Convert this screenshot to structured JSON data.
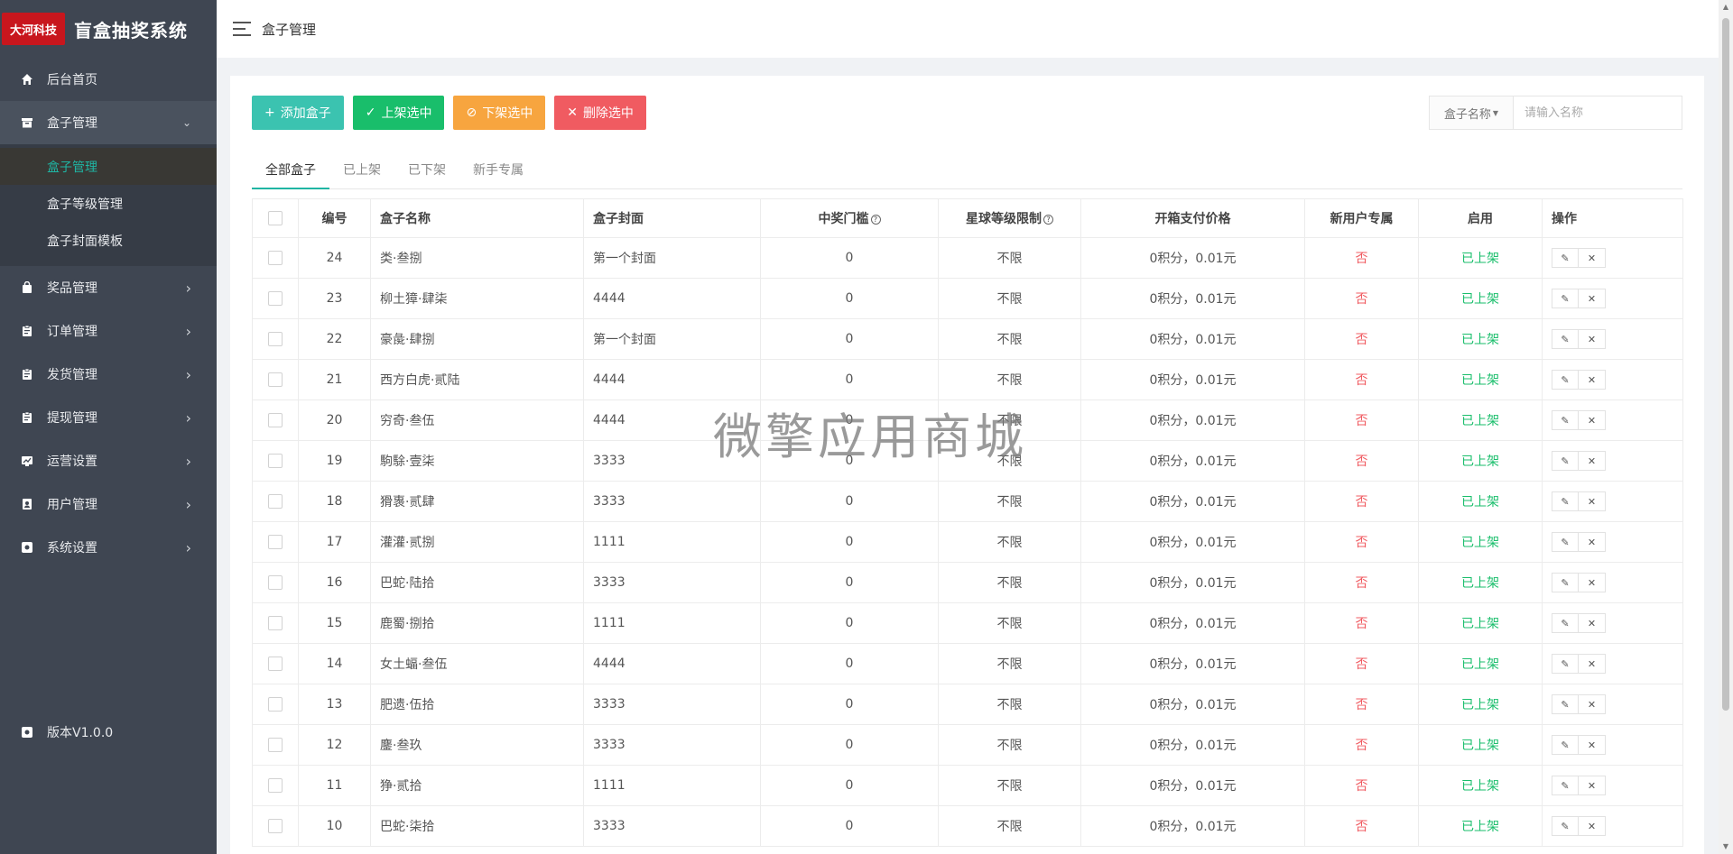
{
  "brand": {
    "logo_text": "大河科技",
    "title": "盲盒抽奖系统"
  },
  "header": {
    "title": "盒子管理"
  },
  "sidebar": {
    "items": [
      {
        "label": "后台首页",
        "icon": "home-icon",
        "has_arrow": false
      },
      {
        "label": "盒子管理",
        "icon": "archive-icon",
        "has_arrow": true,
        "open": true,
        "children": [
          {
            "label": "盒子管理",
            "active": true
          },
          {
            "label": "盒子等级管理",
            "active": false
          },
          {
            "label": "盒子封面模板",
            "active": false
          }
        ]
      },
      {
        "label": "奖品管理",
        "icon": "bag-icon",
        "has_arrow": true
      },
      {
        "label": "订单管理",
        "icon": "clipboard-icon",
        "has_arrow": true
      },
      {
        "label": "发货管理",
        "icon": "clipboard-icon",
        "has_arrow": true
      },
      {
        "label": "提现管理",
        "icon": "clipboard-icon",
        "has_arrow": true
      },
      {
        "label": "运营设置",
        "icon": "chart-icon",
        "has_arrow": true
      },
      {
        "label": "用户管理",
        "icon": "user-card-icon",
        "has_arrow": true
      },
      {
        "label": "系统设置",
        "icon": "gear-icon",
        "has_arrow": true
      }
    ],
    "version": "版本V1.0.0"
  },
  "toolbar": {
    "add_label": "添加盒子",
    "shelve_label": "上架选中",
    "unshelve_label": "下架选中",
    "delete_label": "删除选中"
  },
  "search": {
    "select_label": "盒子名称",
    "placeholder": "请输入名称"
  },
  "tabs": [
    "全部盒子",
    "已上架",
    "已下架",
    "新手专属"
  ],
  "table": {
    "headers": [
      "编号",
      "盒子名称",
      "盒子封面",
      "中奖门槛",
      "星球等级限制",
      "开箱支付价格",
      "新用户专属",
      "启用",
      "操作"
    ],
    "rows": [
      {
        "id": "24",
        "name": "类·叁捌",
        "cover": "第一个封面",
        "threshold": "0",
        "level": "不限",
        "price": "0积分，0.01元",
        "new_user": "否",
        "status": "已上架"
      },
      {
        "id": "23",
        "name": "柳土獐·肆柒",
        "cover": "4444",
        "threshold": "0",
        "level": "不限",
        "price": "0积分，0.01元",
        "new_user": "否",
        "status": "已上架"
      },
      {
        "id": "22",
        "name": "豪彘·肆捌",
        "cover": "第一个封面",
        "threshold": "0",
        "level": "不限",
        "price": "0积分，0.01元",
        "new_user": "否",
        "status": "已上架"
      },
      {
        "id": "21",
        "name": "西方白虎·贰陆",
        "cover": "4444",
        "threshold": "0",
        "level": "不限",
        "price": "0积分，0.01元",
        "new_user": "否",
        "status": "已上架"
      },
      {
        "id": "20",
        "name": "穷奇·叁伍",
        "cover": "4444",
        "threshold": "0",
        "level": "不限",
        "price": "0积分，0.01元",
        "new_user": "否",
        "status": "已上架"
      },
      {
        "id": "19",
        "name": "駒駼·壹柒",
        "cover": "3333",
        "threshold": "0",
        "level": "不限",
        "price": "0积分，0.01元",
        "new_user": "否",
        "status": "已上架"
      },
      {
        "id": "18",
        "name": "猾褢·贰肆",
        "cover": "3333",
        "threshold": "0",
        "level": "不限",
        "price": "0积分，0.01元",
        "new_user": "否",
        "status": "已上架"
      },
      {
        "id": "17",
        "name": "灌灌·贰捌",
        "cover": "1111",
        "threshold": "0",
        "level": "不限",
        "price": "0积分，0.01元",
        "new_user": "否",
        "status": "已上架"
      },
      {
        "id": "16",
        "name": "巴蛇·陆拾",
        "cover": "3333",
        "threshold": "0",
        "level": "不限",
        "price": "0积分，0.01元",
        "new_user": "否",
        "status": "已上架"
      },
      {
        "id": "15",
        "name": "鹿蜀·捌拾",
        "cover": "1111",
        "threshold": "0",
        "level": "不限",
        "price": "0积分，0.01元",
        "new_user": "否",
        "status": "已上架"
      },
      {
        "id": "14",
        "name": "女土蝠·叁伍",
        "cover": "4444",
        "threshold": "0",
        "level": "不限",
        "price": "0积分，0.01元",
        "new_user": "否",
        "status": "已上架"
      },
      {
        "id": "13",
        "name": "肥遗·伍拾",
        "cover": "3333",
        "threshold": "0",
        "level": "不限",
        "price": "0积分，0.01元",
        "new_user": "否",
        "status": "已上架"
      },
      {
        "id": "12",
        "name": "鏖·叁玖",
        "cover": "3333",
        "threshold": "0",
        "level": "不限",
        "price": "0积分，0.01元",
        "new_user": "否",
        "status": "已上架"
      },
      {
        "id": "11",
        "name": "狰·贰拾",
        "cover": "1111",
        "threshold": "0",
        "level": "不限",
        "price": "0积分，0.01元",
        "new_user": "否",
        "status": "已上架"
      },
      {
        "id": "10",
        "name": "巴蛇·柒拾",
        "cover": "3333",
        "threshold": "0",
        "level": "不限",
        "price": "0积分，0.01元",
        "new_user": "否",
        "status": "已上架"
      }
    ]
  },
  "watermark": "微擎应用商城",
  "colors": {
    "sidebar_bg": "#3f4652",
    "accent": "#1fb5a3",
    "teal": "#3bc3b0",
    "green": "#19be6b",
    "orange": "#f7a53f",
    "red": "#f05b61",
    "logo_red": "#c8161d"
  }
}
